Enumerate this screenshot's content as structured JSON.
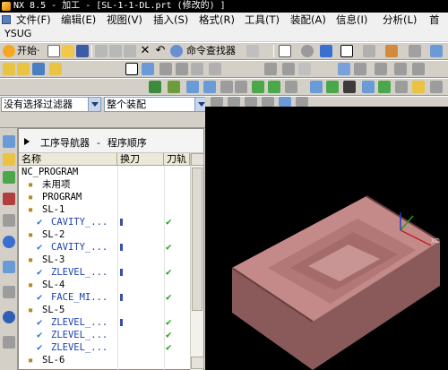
{
  "window": {
    "title": "NX 8.5 - 加工 - [SL-1-1-DL.prt (修改的) ]"
  },
  "menu": [
    "文件(F)",
    "编辑(E)",
    "视图(V)",
    "插入(S)",
    "格式(R)",
    "工具(T)",
    "装配(A)",
    "信息(I)",
    "分析(L)",
    "首"
  ],
  "custom_bar": {
    "label": "YSUG"
  },
  "toolbar": {
    "start_label": "开始·",
    "command_finder_label": "命令查找器"
  },
  "filter": {
    "selection_filter": "没有选择过滤器",
    "assembly_scope": "整个装配"
  },
  "navigator": {
    "title": "工序导航器 - 程序顺序",
    "columns": [
      "名称",
      "换刀",
      "刀轨"
    ],
    "rows": [
      {
        "label": "NC_PROGRAM",
        "indent": 0,
        "tool": false,
        "path": false
      },
      {
        "label": "未用项",
        "indent": 1,
        "tool": false,
        "path": false
      },
      {
        "label": "PROGRAM",
        "indent": 1,
        "tool": false,
        "path": false
      },
      {
        "label": "SL-1",
        "indent": 1,
        "tool": false,
        "path": false
      },
      {
        "label": "CAVITY_...",
        "indent": 2,
        "tool": true,
        "path": true
      },
      {
        "label": "SL-2",
        "indent": 1,
        "tool": false,
        "path": false
      },
      {
        "label": "CAVITY_...",
        "indent": 2,
        "tool": true,
        "path": true
      },
      {
        "label": "SL-3",
        "indent": 1,
        "tool": false,
        "path": false
      },
      {
        "label": "ZLEVEL_...",
        "indent": 2,
        "tool": true,
        "path": true
      },
      {
        "label": "SL-4",
        "indent": 1,
        "tool": false,
        "path": false
      },
      {
        "label": "FACE_MI...",
        "indent": 2,
        "tool": true,
        "path": true
      },
      {
        "label": "SL-5",
        "indent": 1,
        "tool": false,
        "path": false
      },
      {
        "label": "ZLEVEL_...",
        "indent": 2,
        "tool": true,
        "path": true
      },
      {
        "label": "ZLEVEL_...",
        "indent": 2,
        "tool": false,
        "path": true
      },
      {
        "label": "ZLEVEL_...",
        "indent": 2,
        "tool": false,
        "path": true
      },
      {
        "label": "SL-6",
        "indent": 1,
        "tool": false,
        "path": false
      }
    ]
  },
  "viewport": {
    "axis_label": "XC"
  }
}
